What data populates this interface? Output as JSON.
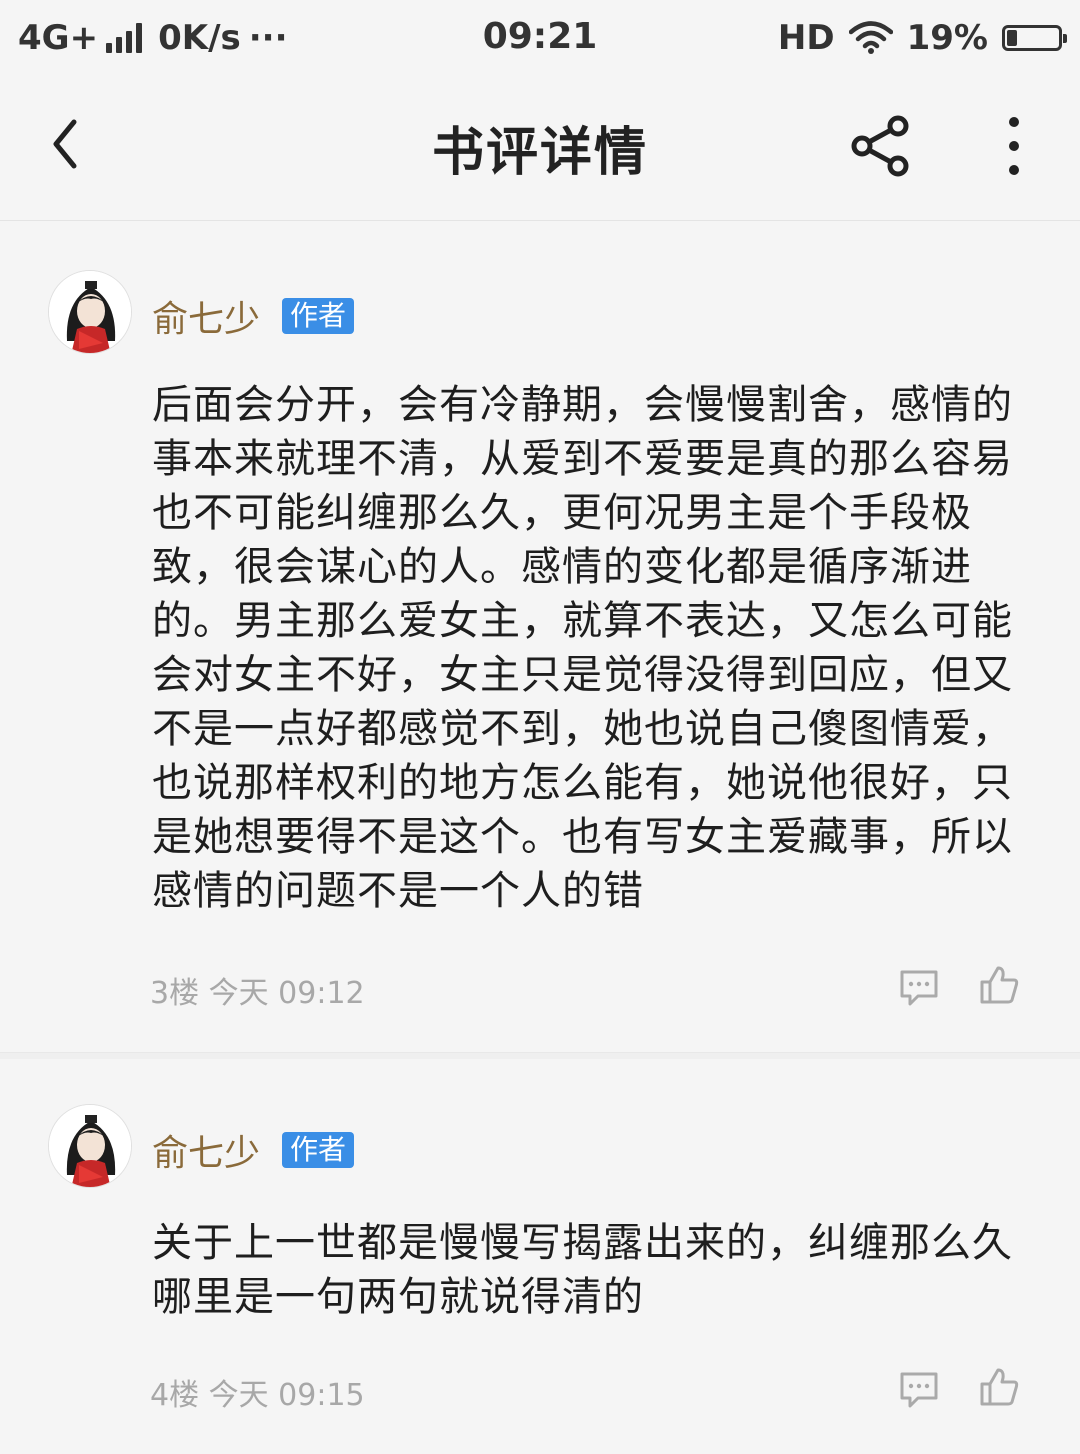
{
  "status_bar": {
    "network": "4G+",
    "speed": "0K/s",
    "dots": "···",
    "time": "09:21",
    "hd": "HD",
    "battery_percent": "19%",
    "battery_level": 0.19
  },
  "header": {
    "title": "书评详情",
    "back_icon": "chevron-left-icon",
    "share_icon": "share-icon",
    "more_icon": "more-vertical-icon"
  },
  "comments": [
    {
      "username": "俞七少",
      "badge": "作者",
      "body": "后面会分开，会有冷静期，会慢慢割舍，感情的事本来就理不清，从爱到不爱要是真的那么容易也不可能纠缠那么久，更何况男主是个手段极致，很会谋心的人。感情的变化都是循序渐进的。男主那么爱女主，就算不表达，又怎么可能会对女主不好，女主只是觉得没得到回应，但又不是一点好都感觉不到，她也说自己傻图情爱，也说那样权利的地方怎么能有，她说他很好，只是她想要得不是这个。也有写女主爱藏事，所以感情的问题不是一个人的错",
      "meta": "3楼 今天 09:12"
    },
    {
      "username": "俞七少",
      "badge": "作者",
      "body": "关于上一世都是慢慢写揭露出来的，纠缠那么久哪里是一句两句就说得清的",
      "meta": "4楼 今天 09:15"
    }
  ],
  "colors": {
    "background": "#f5f5f5",
    "username": "#8a6a3a",
    "badge": "#3a8ee6",
    "meta": "#a8a8a8"
  }
}
